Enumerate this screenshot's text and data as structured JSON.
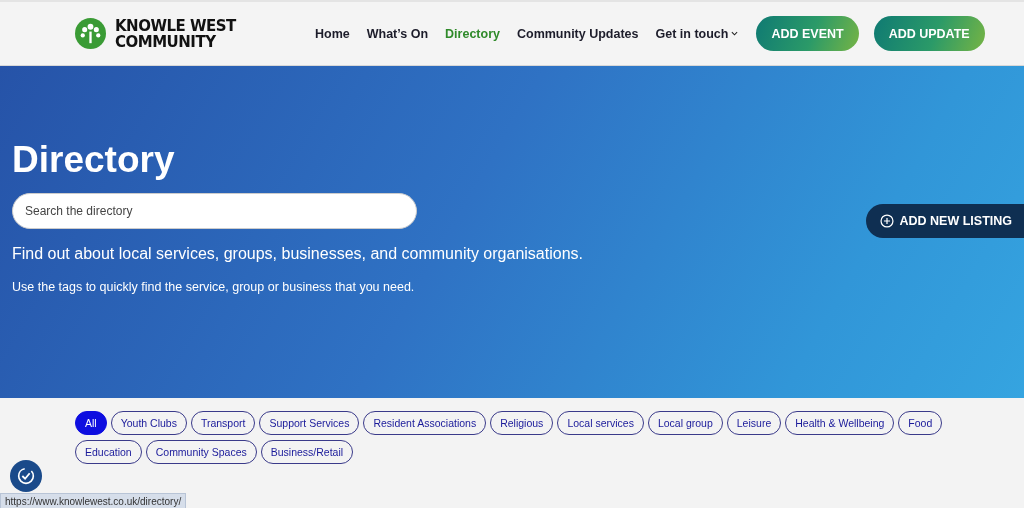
{
  "header": {
    "logo_text": [
      "KNOWLE WEST",
      "COMMUNITY"
    ],
    "nav": [
      {
        "label": "Home",
        "selected": false,
        "dropdown": false
      },
      {
        "label": "What’s On",
        "selected": false,
        "dropdown": false
      },
      {
        "label": "Directory",
        "selected": true,
        "dropdown": false
      },
      {
        "label": "Community Updates",
        "selected": false,
        "dropdown": false
      },
      {
        "label": "Get in touch",
        "selected": false,
        "dropdown": true
      }
    ],
    "buttons": [
      "ADD EVENT",
      "ADD UPDATE"
    ]
  },
  "hero": {
    "title": "Directory",
    "search": {
      "placeholder": "Search the directory"
    },
    "intro": "Find out about local services, groups, businesses, and community organisations.",
    "hint": "Use the tags to quickly find the service, group or business that you need.",
    "add_button": "ADD NEW LISTING"
  },
  "tags": [
    {
      "label": "All",
      "selected": true
    },
    {
      "label": "Youth Clubs",
      "selected": false
    },
    {
      "label": "Transport",
      "selected": false
    },
    {
      "label": "Support Services",
      "selected": false
    },
    {
      "label": "Resident Associations",
      "selected": false
    },
    {
      "label": "Religious",
      "selected": false
    },
    {
      "label": "Local services",
      "selected": false
    },
    {
      "label": "Local group",
      "selected": false
    },
    {
      "label": "Leisure",
      "selected": false
    },
    {
      "label": "Health & Wellbeing",
      "selected": false
    },
    {
      "label": "Food",
      "selected": false
    },
    {
      "label": "Education",
      "selected": false
    },
    {
      "label": "Community Spaces",
      "selected": false
    },
    {
      "label": "Business/Retail",
      "selected": false
    }
  ],
  "status_bar": {
    "url": "https://www.knowlewest.co.uk/directory/"
  }
}
